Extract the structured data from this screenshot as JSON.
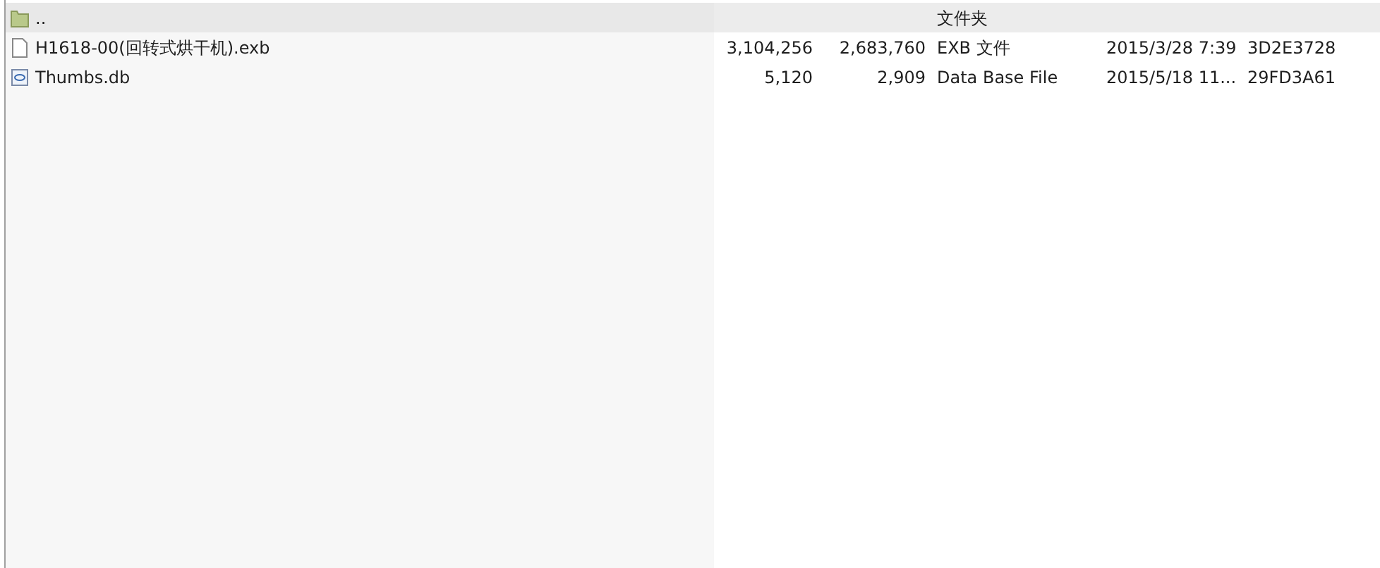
{
  "file_list": {
    "rows": [
      {
        "kind": "folder",
        "name": "..",
        "type": "文件夹",
        "selected": true
      },
      {
        "kind": "file",
        "name": "H1618-00(回转式烘干机).exb",
        "size": "3,104,256",
        "packed": "2,683,760",
        "type": "EXB 文件",
        "modified": "2015/3/28 7:39",
        "crc": "3D2E3728",
        "selected": false
      },
      {
        "kind": "database",
        "name": "Thumbs.db",
        "size": "5,120",
        "packed": "2,909",
        "type": "Data Base File",
        "modified": "2015/5/18 11...",
        "crc": "29FD3A61",
        "selected": false
      }
    ]
  }
}
